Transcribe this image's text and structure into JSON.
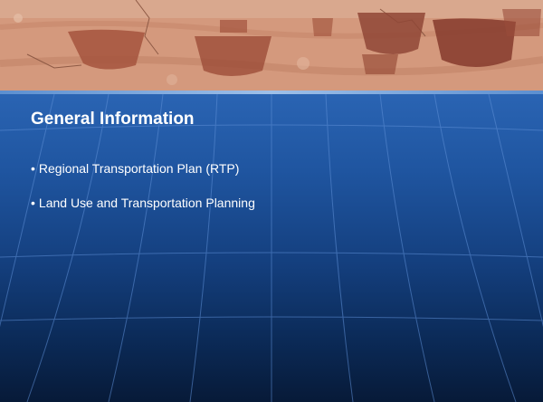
{
  "slide": {
    "title": "General Information",
    "bullets": [
      "Regional Transportation Plan (RTP)",
      "Land Use and Transportation Planning"
    ],
    "bullet_glyph": "•"
  },
  "theme": {
    "banner_image": "rock-petroglyph-photo",
    "body_gradient_top": "#2a64b3",
    "body_gradient_bottom": "#071a38",
    "text_color": "#ffffff"
  }
}
